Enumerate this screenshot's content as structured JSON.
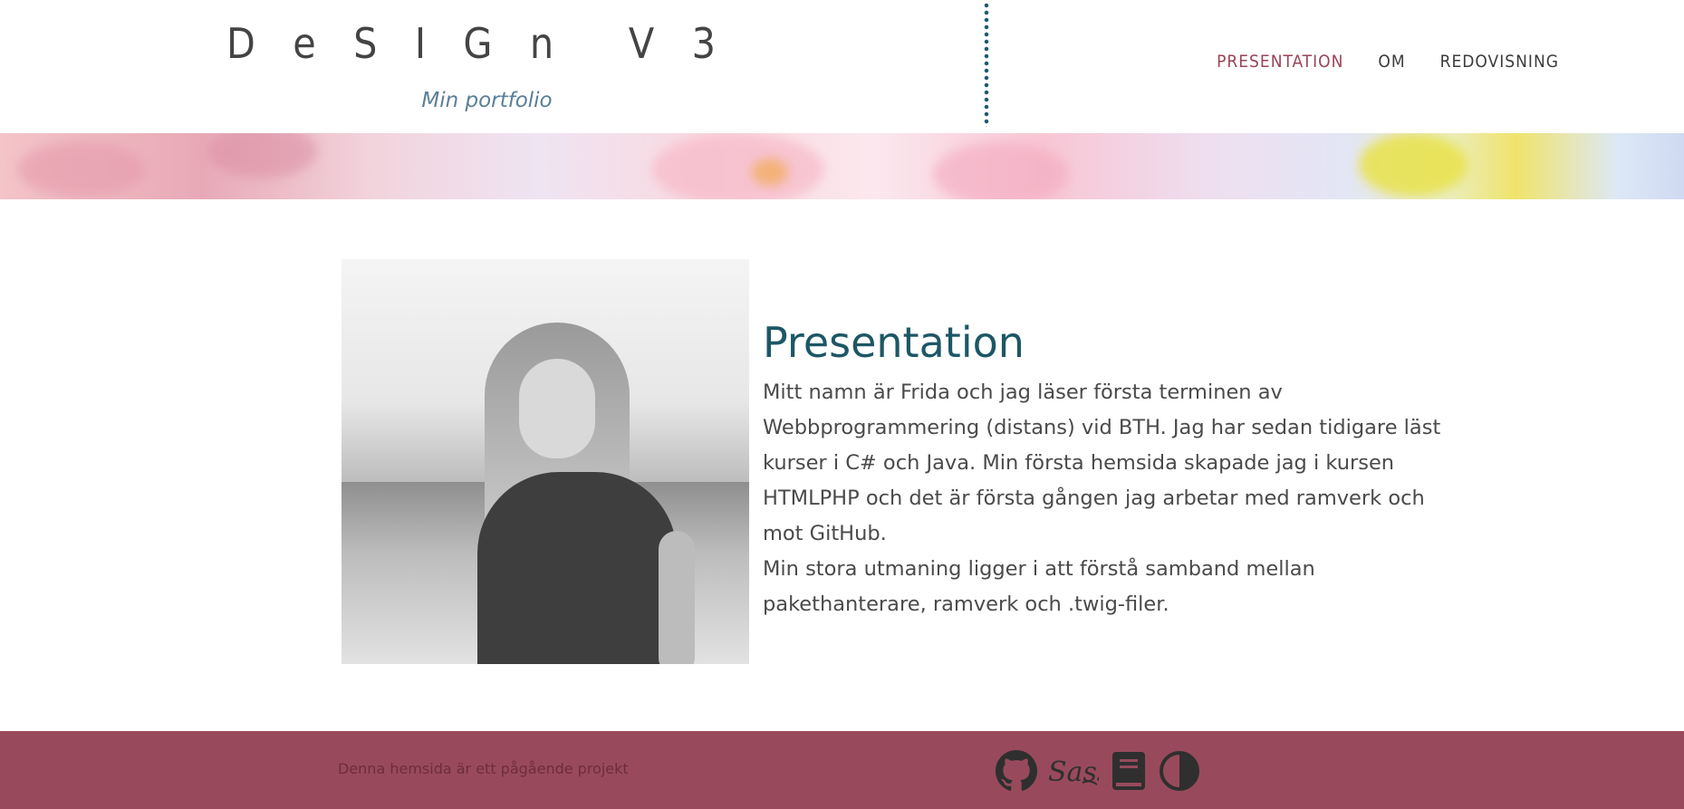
{
  "header": {
    "site_title_letters": [
      "D",
      "e",
      "S",
      "I",
      "G",
      "n",
      "",
      "V",
      "3"
    ],
    "subtitle": "Min portfolio"
  },
  "nav": {
    "items": [
      {
        "label": "Presentation",
        "active": true
      },
      {
        "label": "Om",
        "active": false
      },
      {
        "label": "Redovisning",
        "active": false
      }
    ]
  },
  "main": {
    "heading": "Presentation",
    "paragraphs": [
      "Mitt namn är Frida och jag läser första terminen av Webbprogrammering (distans) vid BTH. Jag har sedan tidigare läst kurser i C# och Java. Min första hemsida skapade jag i kursen HTMLPHP och det är första gången jag arbetar med ramverk och mot GitHub.",
      "Min stora utmaning ligger i att förstå samband mellan pakethanterare, ramverk och .twig-filer."
    ]
  },
  "footer": {
    "text": "Denna hemsida är ett pågående projekt",
    "icons": [
      "github-icon",
      "sass-icon",
      "book-icon",
      "contrast-icon"
    ]
  },
  "colors": {
    "accent": "#9a4458",
    "heading": "#1d5766",
    "subtitle": "#5a7f98",
    "footer_bg": "#984a5c",
    "footer_icon": "#2f2f2f"
  }
}
